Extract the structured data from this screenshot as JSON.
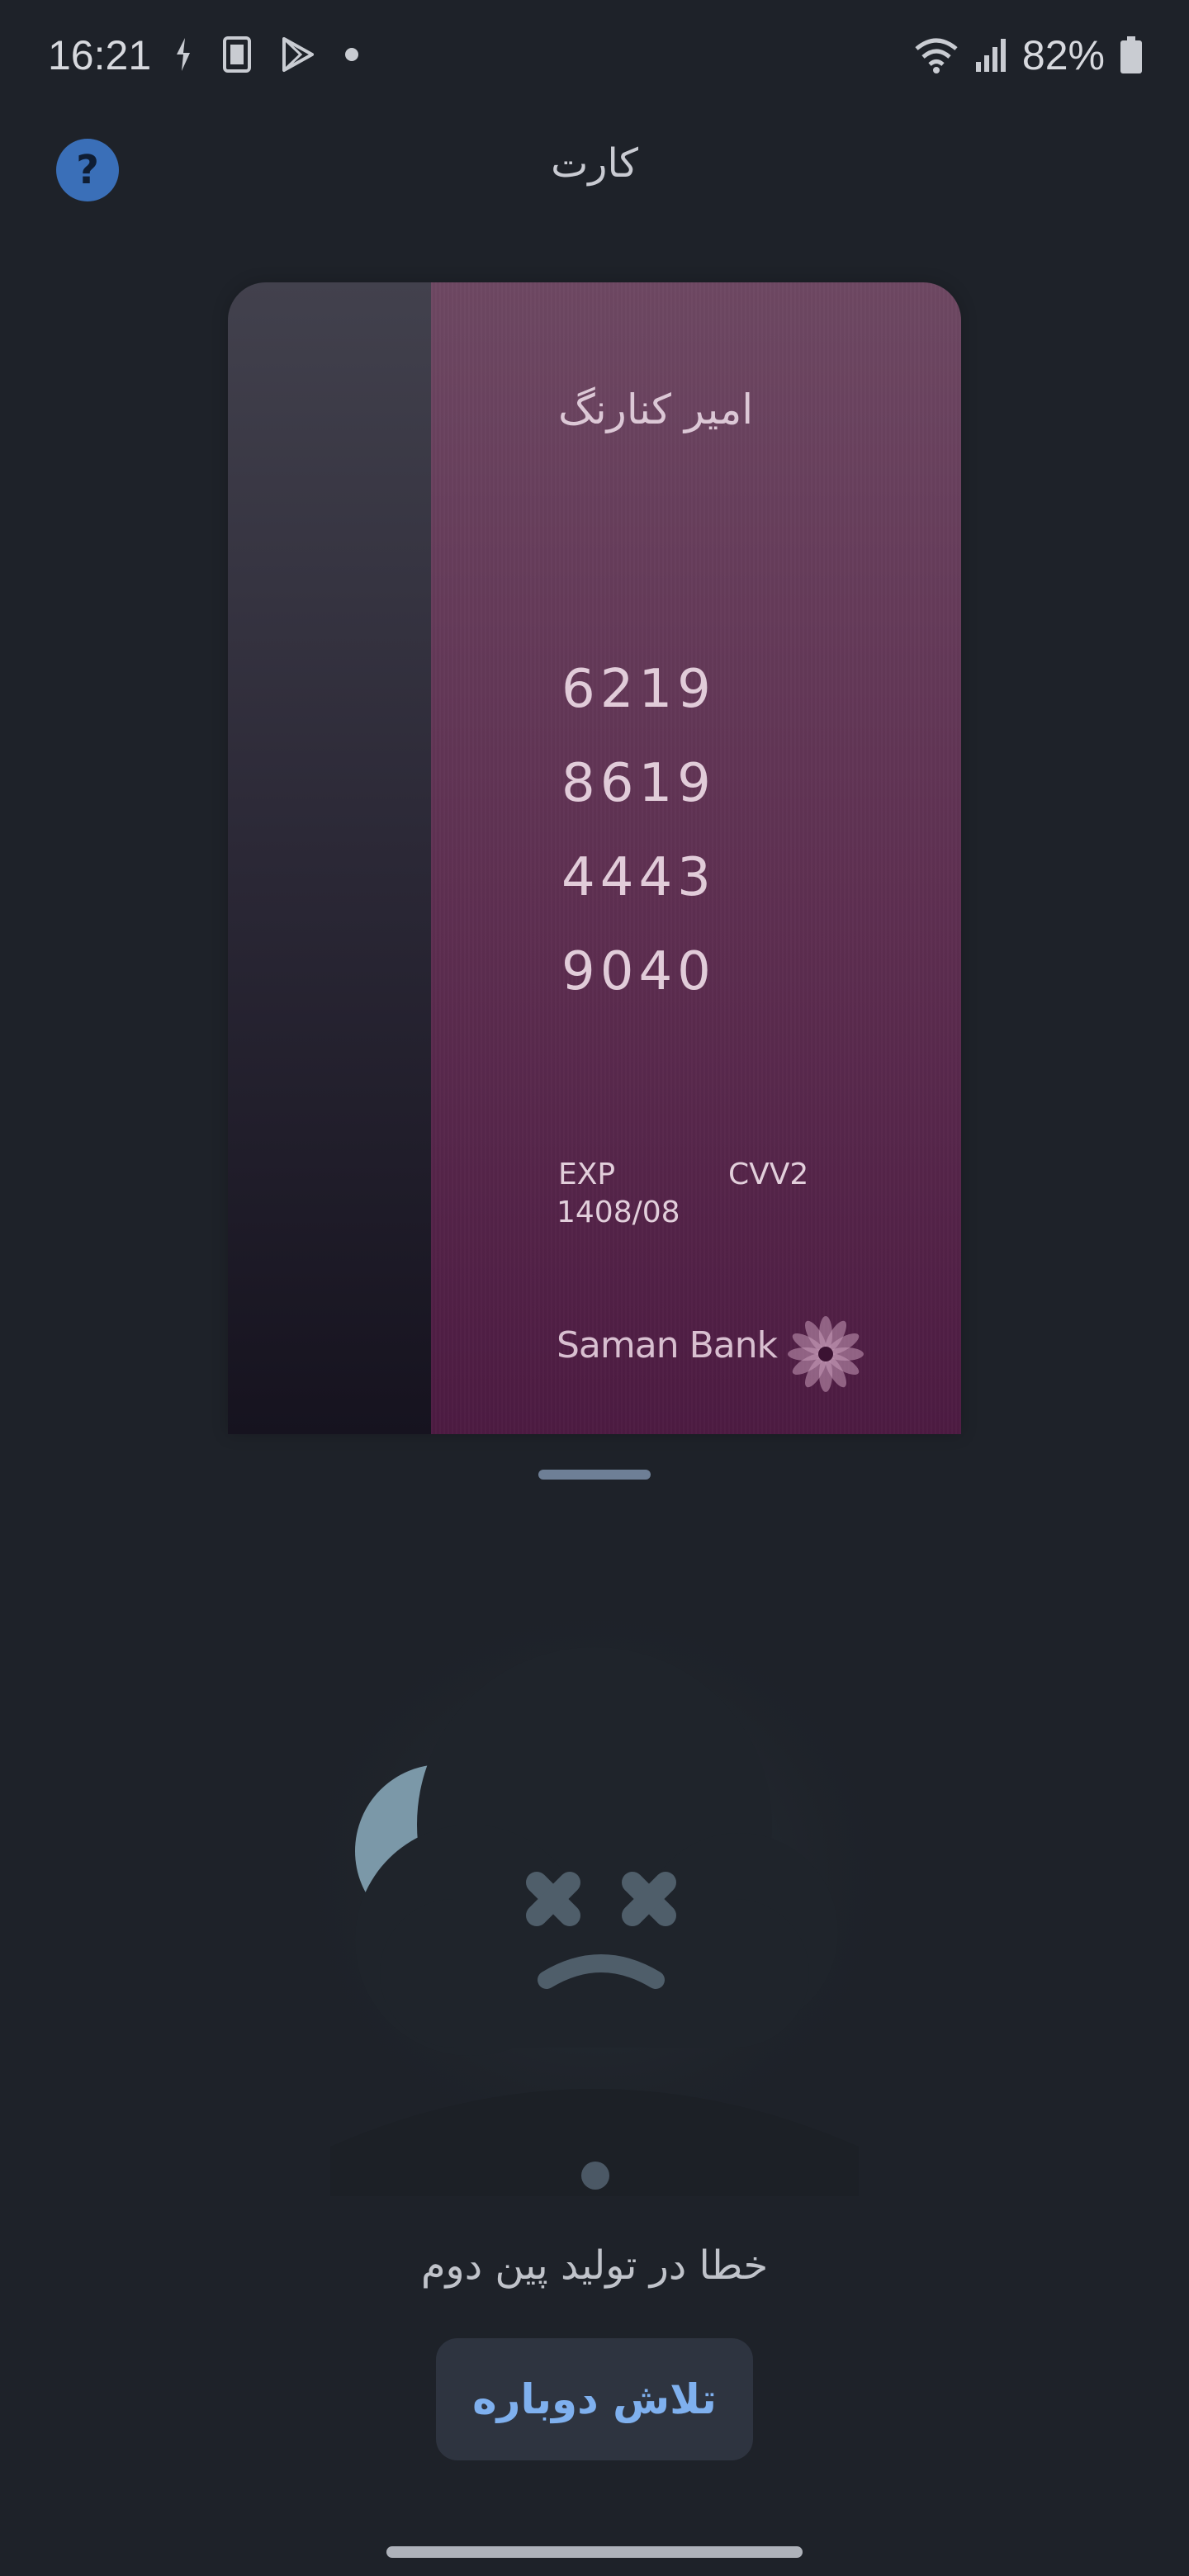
{
  "status_bar": {
    "time": "16:21",
    "battery": "82%",
    "icons": [
      "transfer-icon",
      "screenshot-icon",
      "play-store-icon",
      "dot-icon",
      "wifi-icon",
      "signal-icon",
      "battery-icon"
    ]
  },
  "header": {
    "title": "کارت",
    "help_label": "?"
  },
  "card": {
    "holder_name": "امیر کنارنگ",
    "number_groups": [
      "6219",
      "8619",
      "4443",
      "9040"
    ],
    "exp_label": "EXP",
    "cvv_label": "CVV2",
    "exp_value": "1408/08",
    "bank_name": "Saman Bank",
    "colors": {
      "face_top": "#6e4863",
      "face_bottom": "#4d1b42"
    }
  },
  "error": {
    "message": "خطا در تولید پین دوم",
    "retry_label": "تلاش دوباره"
  },
  "colors": {
    "background": "#1e2229",
    "accent": "#3a6fb8",
    "retry_text": "#7fb0ee"
  }
}
